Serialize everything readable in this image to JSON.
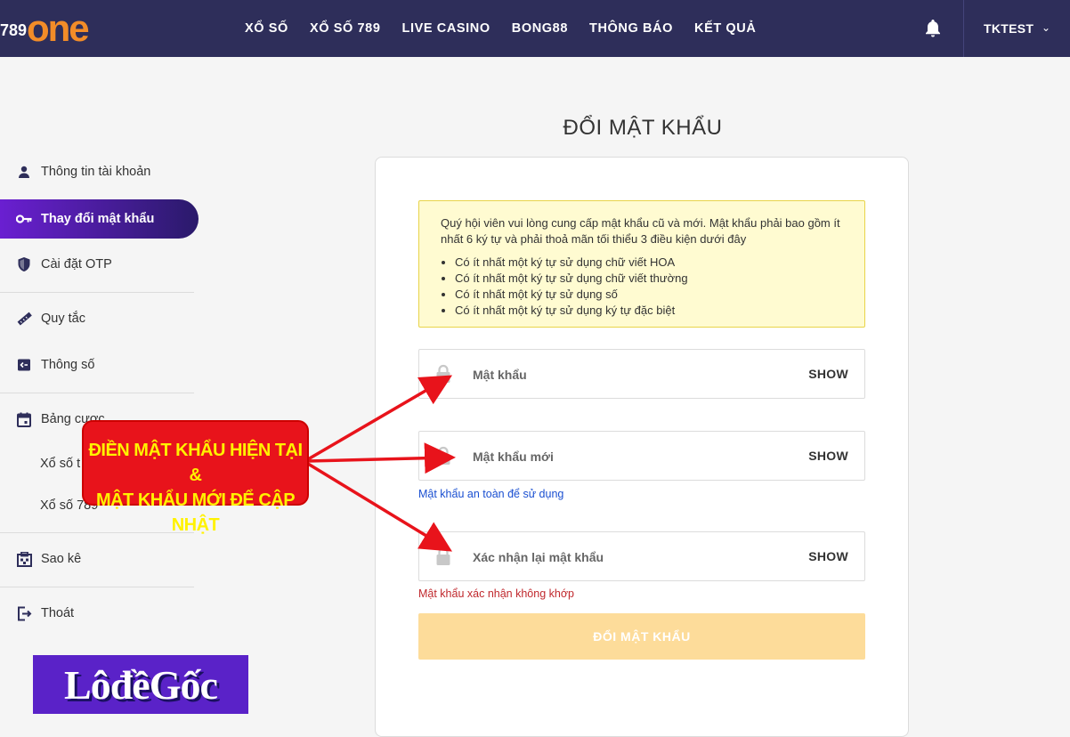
{
  "header": {
    "logo_num": "789",
    "logo_word": "one",
    "nav": [
      "XỔ SỐ",
      "XỔ SỐ 789",
      "LIVE CASINO",
      "BONG88",
      "THÔNG BÁO",
      "KẾT QUẢ"
    ],
    "user_name": "TKTEST"
  },
  "sidebar": {
    "account_info": "Thông tin tài khoản",
    "change_password": "Thay đổi mật khẩu",
    "otp_settings": "Cài đặt OTP",
    "rules": "Quy tắc",
    "parameters": "Thông số",
    "bet_table": "Bảng cược",
    "sub_lottery": "Xổ số t",
    "sub_lottery789": "Xổ số 789",
    "statement": "Sao kê",
    "logout": "Thoát"
  },
  "main": {
    "title": "ĐỔI MẬT KHẨU",
    "notice_intro": "Quý hội viên vui lòng cung cấp mật khẩu cũ và mới. Mật khẩu phải bao gồm ít nhất 6 ký tự và phải thoả mãn tối thiểu 3 điều kiện dưới đây",
    "rules": [
      "Có ít nhất một ký tự sử dụng chữ viết HOA",
      "Có ít nhất một ký tự sử dụng chữ viết thường",
      "Có ít nhất một ký tự sử dụng số",
      "Có ít nhất một ký tự sử dụng ký tự đặc biệt"
    ],
    "field_current": {
      "placeholder": "Mật khẩu",
      "show": "SHOW"
    },
    "field_new": {
      "placeholder": "Mật khẩu mới",
      "show": "SHOW"
    },
    "new_hint": "Mật khẩu an toàn để sử dụng",
    "field_confirm": {
      "placeholder": "Xác nhận lại mật khẩu",
      "show": "SHOW"
    },
    "confirm_error": "Mật khẩu xác nhận không khớp",
    "submit_label": "ĐỔI MẬT KHẨU"
  },
  "annotation": {
    "line1": "ĐIỀN MẬT KHẨU HIỆN TẠI &",
    "line2": "MẬT KHẨU MỚI ĐỂ CẬP NHẬT"
  },
  "watermark": "LôđềGốc",
  "colors": {
    "header_bg": "#2e2e5a",
    "logo_orange": "#f28c28",
    "active_gradient_start": "#6a1fd1",
    "notice_bg": "#fffbd1",
    "submit_bg": "#fddc9a",
    "error_red": "#c0282d",
    "hint_blue": "#1a4fd1",
    "callout_red": "#e8131b",
    "callout_text": "#fff200"
  }
}
